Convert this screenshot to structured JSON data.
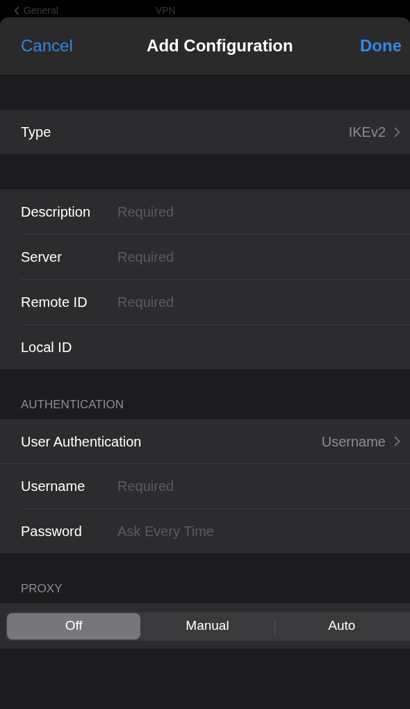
{
  "background_nav": {
    "back": "General",
    "title": "VPN"
  },
  "nav": {
    "cancel": "Cancel",
    "title": "Add Configuration",
    "done": "Done"
  },
  "sections": [
    {
      "rows": [
        {
          "kind": "disclosure",
          "label": "Type",
          "value": "IKEv2"
        }
      ]
    },
    {
      "rows": [
        {
          "kind": "field",
          "label": "Description",
          "placeholder": "Required"
        },
        {
          "kind": "field",
          "label": "Server",
          "placeholder": "Required"
        },
        {
          "kind": "field",
          "label": "Remote ID",
          "placeholder": "Required"
        },
        {
          "kind": "field",
          "label": "Local ID"
        }
      ]
    },
    {
      "header": "AUTHENTICATION",
      "rows": [
        {
          "kind": "disclosure",
          "label": "User Authentication",
          "value": "Username"
        },
        {
          "kind": "field",
          "label": "Username",
          "placeholder": "Required"
        },
        {
          "kind": "field",
          "label": "Password",
          "placeholder": "Ask Every Time"
        }
      ]
    }
  ],
  "proxy": {
    "header": "PROXY",
    "options": [
      {
        "label": "Off",
        "selected": true
      },
      {
        "label": "Manual",
        "selected": false
      },
      {
        "label": "Auto",
        "selected": false
      }
    ]
  }
}
